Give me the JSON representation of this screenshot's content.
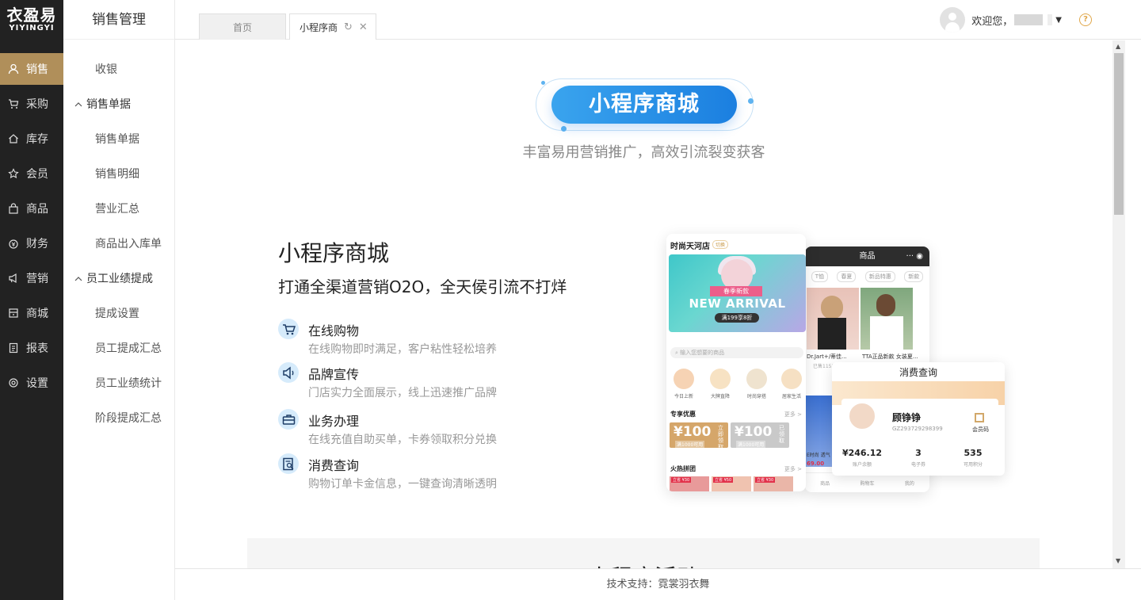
{
  "logo": {
    "zh": "衣盈易",
    "en": "YIYINGYI"
  },
  "nav": [
    {
      "label": "销售",
      "icon": "user-icon",
      "active": true
    },
    {
      "label": "采购",
      "icon": "cart-icon"
    },
    {
      "label": "库存",
      "icon": "home-icon"
    },
    {
      "label": "会员",
      "icon": "star-icon"
    },
    {
      "label": "商品",
      "icon": "bag-icon"
    },
    {
      "label": "财务",
      "icon": "money-icon"
    },
    {
      "label": "营销",
      "icon": "megaphone-icon"
    },
    {
      "label": "商城",
      "icon": "store-icon"
    },
    {
      "label": "报表",
      "icon": "report-icon"
    },
    {
      "label": "设置",
      "icon": "gear-icon"
    }
  ],
  "submenu": {
    "title": "销售管理",
    "items": [
      {
        "label": "收银",
        "type": "item"
      },
      {
        "label": "销售单据",
        "type": "group"
      },
      {
        "label": "销售单据",
        "type": "item"
      },
      {
        "label": "销售明细",
        "type": "item"
      },
      {
        "label": "营业汇总",
        "type": "item"
      },
      {
        "label": "商品出入库单",
        "type": "item"
      },
      {
        "label": "员工业绩提成",
        "type": "group"
      },
      {
        "label": "提成设置",
        "type": "item"
      },
      {
        "label": "员工提成汇总",
        "type": "item"
      },
      {
        "label": "员工业绩统计",
        "type": "item"
      },
      {
        "label": "阶段提成汇总",
        "type": "item"
      }
    ]
  },
  "tabs": [
    {
      "label": "首页"
    },
    {
      "label": "小程序商"
    }
  ],
  "user": {
    "greeting": "欢迎您，"
  },
  "help_icon": "?",
  "hero": {
    "title": "小程序商城",
    "subtitle": "丰富易用营销推广，高效引流裂变获客"
  },
  "features": {
    "title": "小程序商城",
    "subtitle": "打通全渠道营销O2O，全天侯引流不打烊",
    "items": [
      {
        "name": "在线购物",
        "desc": "在线购物即时满足，客户粘性轻松培养",
        "icon": "cart-icon"
      },
      {
        "name": "品牌宣传",
        "desc": "门店实力全面展示，线上迅速推广品牌",
        "icon": "speaker-icon"
      },
      {
        "name": "业务办理",
        "desc": "在线充值自助买单，卡券领取积分兑换",
        "icon": "briefcase-icon"
      },
      {
        "name": "消费查询",
        "desc": "购物订单卡金信息，一键查询清晰透明",
        "icon": "search-doc-icon"
      }
    ]
  },
  "mockup": {
    "shop_name": "时尚天河店",
    "shop_badge": "切换",
    "banner_tag": "春季新款",
    "banner_text": "NEW ARRIVAL",
    "banner_deal": "满199享8折",
    "search_placeholder": "输入您想要的商品",
    "categories": [
      "今日上新",
      "大牌直降",
      "时尚穿搭",
      "居家生活"
    ],
    "promo_title": "专享优惠",
    "more": "更多 >",
    "coupons": [
      {
        "value": "¥100",
        "note": "满1000可用",
        "action": "立即领取",
        "color": "#d5a66a"
      },
      {
        "value": "¥100",
        "note": "满1000可用",
        "action": "已领取",
        "color": "#c9c9c9"
      }
    ],
    "hot_title": "火热拼团",
    "hot_tags": [
      "立省 ¥30",
      "立省 ¥50",
      "立省 ¥30"
    ],
    "back_title": "商品",
    "back_chips": [
      "T恤",
      "春夏",
      "新品特惠",
      "新款"
    ],
    "back_items": [
      "Dr.Jart+/蒂佳...",
      "TTA正品新款 女装夏..."
    ],
    "back_line": "已售1152",
    "back_price_text": "E时尚 透气",
    "back_price": "69.00",
    "back_nav": [
      "商品",
      "购物车",
      "我的"
    ],
    "card": {
      "title": "消费查询",
      "name": "顾铮铮",
      "id": "GZ293729298399",
      "qr_label": "会员码",
      "stats": [
        {
          "value": "¥246.12",
          "label": "账户余额"
        },
        {
          "value": "3",
          "label": "电子券"
        },
        {
          "value": "535",
          "label": "可用积分"
        }
      ]
    }
  },
  "next_section_title": "小程序活动",
  "footer": "技术支持：霓裳羽衣舞"
}
